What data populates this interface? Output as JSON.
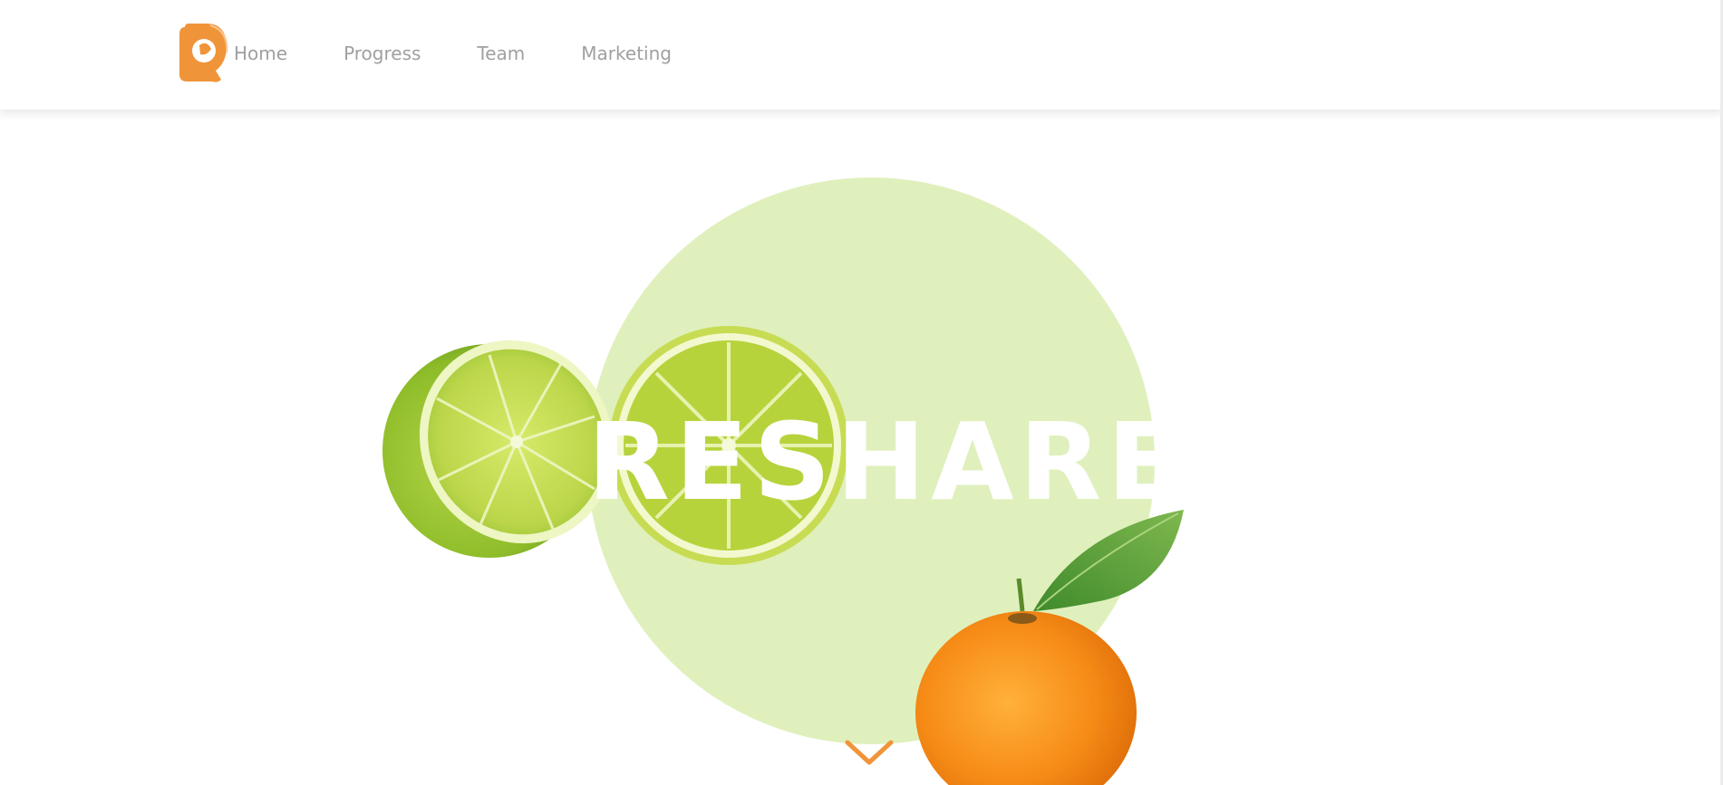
{
  "nav": {
    "items": [
      {
        "label": "Home"
      },
      {
        "label": "Progress"
      },
      {
        "label": "Team"
      },
      {
        "label": "Marketing"
      }
    ]
  },
  "hero": {
    "title": "RESHARE",
    "circle_color": "#dff0bd",
    "scroll_icon": "chevron-down-icon"
  },
  "colors": {
    "brand": "#f0943a",
    "nav_text": "#a0a0a0",
    "lime": "#a8cc3a",
    "orange": "#f58d1d"
  }
}
